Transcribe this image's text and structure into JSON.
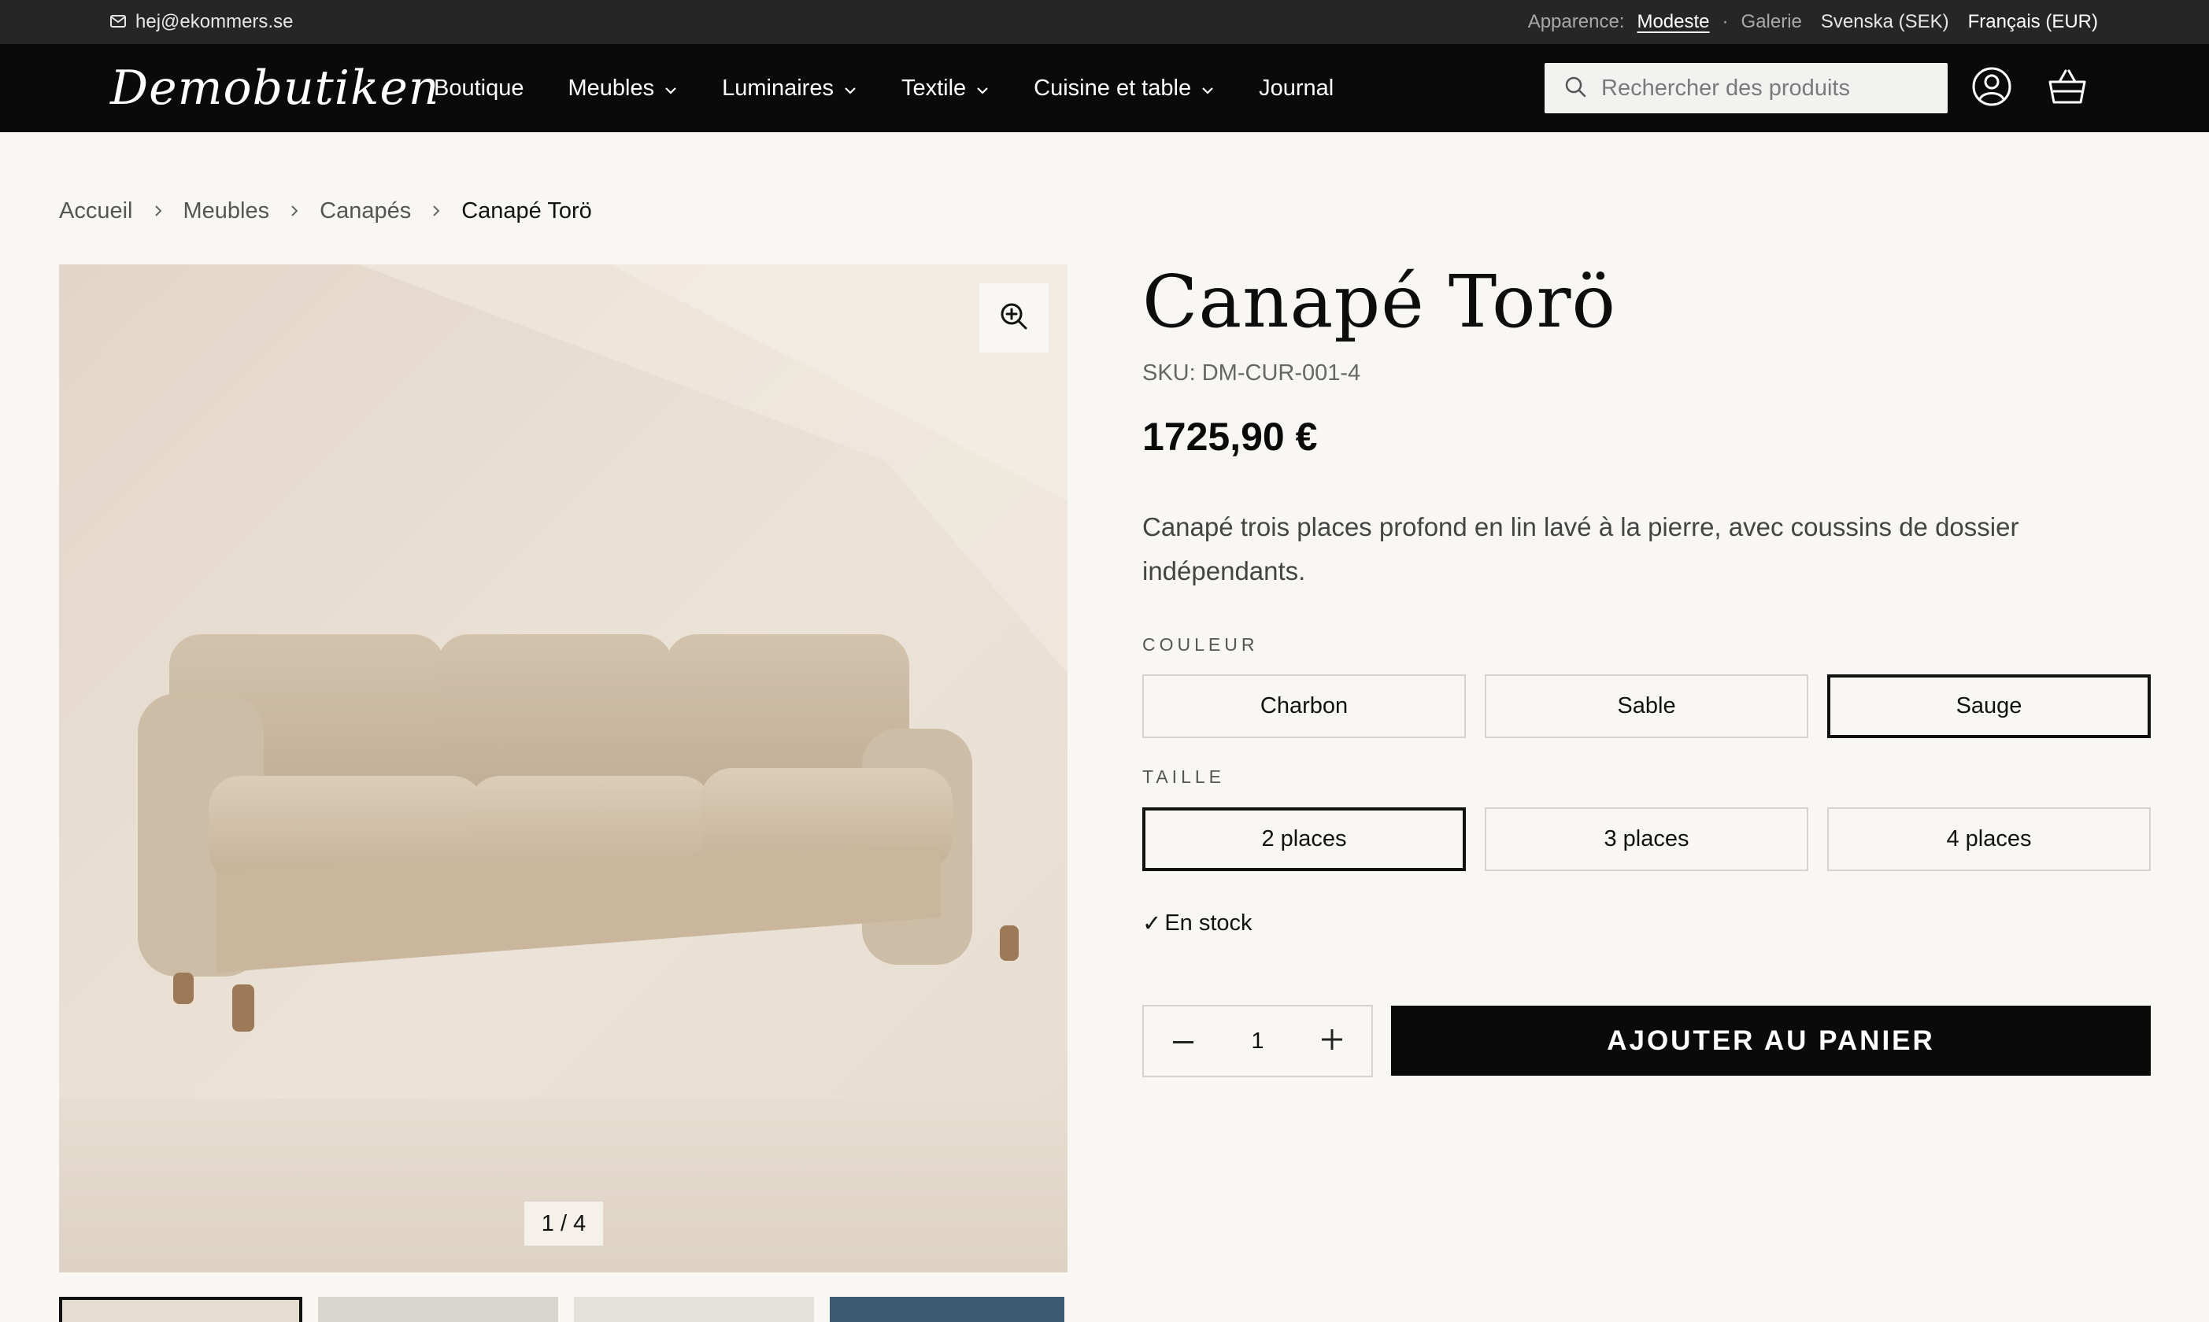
{
  "topbar": {
    "email": "hej@ekommers.se",
    "appearance_label": "Apparence:",
    "theme_active": "Modeste",
    "theme_separator": "·",
    "theme_other": "Galerie",
    "lang_1": "Svenska (SEK)",
    "lang_2": "Français (EUR)"
  },
  "nav": {
    "logo": "Demobutiken",
    "items": [
      {
        "label": "Boutique",
        "has_dropdown": false
      },
      {
        "label": "Meubles",
        "has_dropdown": true
      },
      {
        "label": "Luminaires",
        "has_dropdown": true
      },
      {
        "label": "Textile",
        "has_dropdown": true
      },
      {
        "label": "Cuisine et table",
        "has_dropdown": true
      },
      {
        "label": "Journal",
        "has_dropdown": false
      }
    ],
    "search_placeholder": "Rechercher des produits"
  },
  "breadcrumb": [
    "Accueil",
    "Meubles",
    "Canapés",
    "Canapé Torö"
  ],
  "gallery": {
    "counter": "1 / 4",
    "image_count": 4
  },
  "product": {
    "title": "Canapé Torö",
    "sku": "SKU: DM-CUR-001-4",
    "price": "1725,90 €",
    "description": "Canapé trois places profond en lin lavé à la pierre, avec coussins de dossier indépendants.",
    "color_label": "COULEUR",
    "colors": [
      "Charbon",
      "Sable",
      "Sauge"
    ],
    "color_selected": "Sauge",
    "size_label": "TAILLE",
    "sizes": [
      "2 places",
      "3 places",
      "4 places"
    ],
    "size_selected": "2 places",
    "stock_mark": "✓",
    "stock": "En stock",
    "quantity": "1",
    "add_to_cart": "AJOUTER AU PANIER"
  },
  "colors": {
    "topbar_bg": "#262626",
    "nav_bg": "#0a0a0a",
    "page_bg": "#f8f7f3",
    "button_bg": "#0a0a0a"
  }
}
